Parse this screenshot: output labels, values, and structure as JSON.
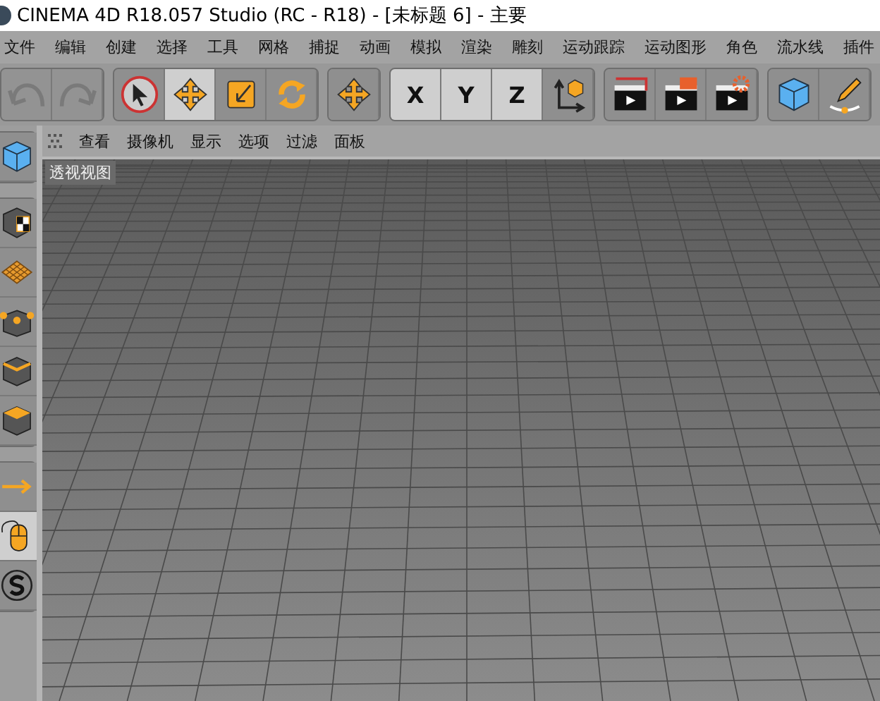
{
  "window": {
    "title": "CINEMA 4D R18.057 Studio (RC - R18) - [未标题 6] - 主要"
  },
  "menu": [
    "文件",
    "编辑",
    "创建",
    "选择",
    "工具",
    "网格",
    "捕捉",
    "动画",
    "模拟",
    "渲染",
    "雕刻",
    "运动跟踪",
    "运动图形",
    "角色",
    "流水线",
    "插件"
  ],
  "toolbar": [
    [
      {
        "kind": "undo",
        "selected": false,
        "disabled": true
      },
      {
        "kind": "redo",
        "selected": false,
        "disabled": true
      }
    ],
    [
      {
        "kind": "select",
        "selected": false,
        "disabled": false
      },
      {
        "kind": "move",
        "selected": true,
        "disabled": false
      },
      {
        "kind": "scale",
        "selected": false,
        "disabled": false
      },
      {
        "kind": "rotate",
        "selected": false,
        "disabled": false
      }
    ],
    [
      {
        "kind": "move",
        "selected": false,
        "disabled": false
      }
    ],
    [
      {
        "kind": "axis",
        "label": "X",
        "selected": true,
        "disabled": false
      },
      {
        "kind": "axis",
        "label": "Y",
        "selected": true,
        "disabled": false
      },
      {
        "kind": "axis",
        "label": "Z",
        "selected": true,
        "disabled": false
      },
      {
        "kind": "coords",
        "selected": false,
        "disabled": false
      }
    ],
    [
      {
        "kind": "render-view",
        "selected": false,
        "disabled": false
      },
      {
        "kind": "render",
        "selected": false,
        "disabled": false
      },
      {
        "kind": "render-settings",
        "selected": false,
        "disabled": false
      }
    ],
    [
      {
        "kind": "cube",
        "selected": false,
        "disabled": false
      },
      {
        "kind": "pen",
        "selected": false,
        "disabled": false
      }
    ]
  ],
  "view_menu": [
    "查看",
    "摄像机",
    "显示",
    "选项",
    "过滤",
    "面板"
  ],
  "viewport": {
    "label": "透视视图"
  },
  "left_tools": [
    [
      {
        "kind": "cube",
        "selected": false
      }
    ],
    [
      {
        "kind": "texture-cube",
        "selected": false
      },
      {
        "kind": "plane",
        "selected": false
      },
      {
        "kind": "points",
        "selected": false
      },
      {
        "kind": "edges",
        "selected": false
      },
      {
        "kind": "polygons",
        "selected": false
      }
    ],
    [
      {
        "kind": "arrow",
        "selected": false
      },
      {
        "kind": "mouse",
        "selected": true
      },
      {
        "kind": "snap",
        "selected": false
      }
    ]
  ]
}
